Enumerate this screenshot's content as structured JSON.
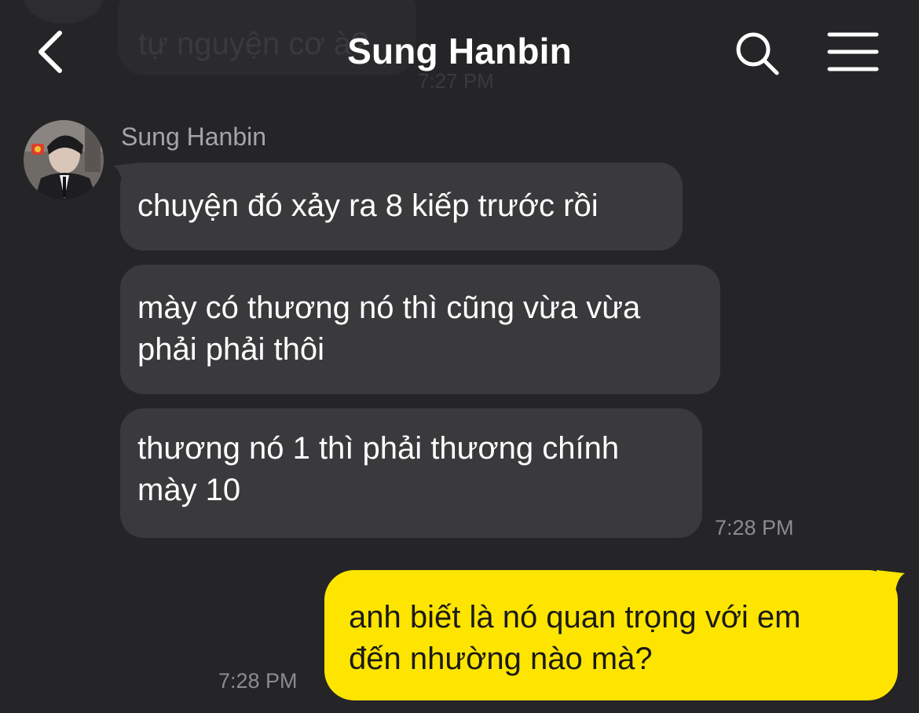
{
  "header": {
    "title": "Sung Hanbin",
    "back_icon": "chevron-left-icon",
    "search_icon": "search-icon",
    "menu_icon": "hamburger-menu-icon"
  },
  "previous_message": {
    "text": "tự nguyện cơ à?",
    "time": "7:27 PM"
  },
  "incoming": {
    "sender_name": "Sung Hanbin",
    "messages": [
      {
        "lines": [
          "chuyện đó xảy ra 8 kiếp trước rồi"
        ]
      },
      {
        "lines": [
          "mày có thương nó thì cũng vừa vừa",
          "phải phải thôi"
        ]
      },
      {
        "lines": [
          "thương nó 1 thì phải thương chính",
          "mày 10"
        ]
      }
    ],
    "time": "7:28 PM"
  },
  "outgoing": {
    "messages": [
      {
        "lines": [
          "anh biết là nó quan trọng với em",
          "đến nhường nào mà?"
        ]
      }
    ],
    "time": "7:28 PM"
  },
  "colors": {
    "background": "#252527",
    "incoming_bubble": "#3a3a3c",
    "outgoing_bubble": "#fee500",
    "timestamp": "#8c8c90"
  }
}
